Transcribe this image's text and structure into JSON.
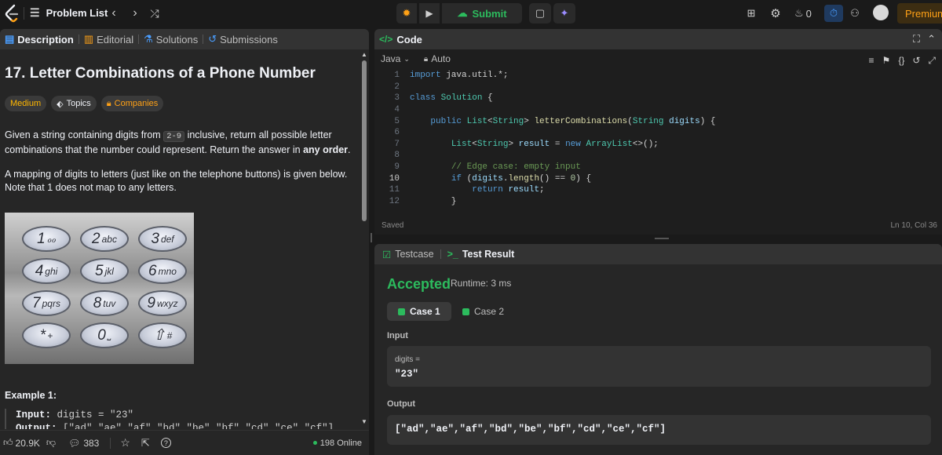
{
  "topbar": {
    "problem_list": "Problem List",
    "submit_label": "Submit",
    "streak_count": "0",
    "premium_label": "Premium"
  },
  "tabs": {
    "description": "Description",
    "editorial": "Editorial",
    "solutions": "Solutions",
    "submissions": "Submissions"
  },
  "problem": {
    "title": "17. Letter Combinations of a Phone Number",
    "difficulty": "Medium",
    "topics": "Topics",
    "companies": "Companies",
    "desc_part1": "Given a string containing digits from ",
    "desc_code": "2-9",
    "desc_part2": " inclusive, return all possible letter combinations that the number could represent. Return the answer in ",
    "desc_bold": "any order",
    "desc_part3": ".",
    "mapping_text": "A mapping of digits to letters (just like on the telephone buttons) is given below. Note that 1 does not map to any letters.",
    "keypad": [
      {
        "digit": "1",
        "letters": "ℴℴ"
      },
      {
        "digit": "2",
        "letters": "abc"
      },
      {
        "digit": "3",
        "letters": "def"
      },
      {
        "digit": "4",
        "letters": "ghi"
      },
      {
        "digit": "5",
        "letters": "jkl"
      },
      {
        "digit": "6",
        "letters": "mno"
      },
      {
        "digit": "7",
        "letters": "pqrs"
      },
      {
        "digit": "8",
        "letters": "tuv"
      },
      {
        "digit": "9",
        "letters": "wxyz"
      },
      {
        "digit": "*",
        "letters": "+"
      },
      {
        "digit": "0",
        "letters": "⎵"
      },
      {
        "digit": "⇧",
        "letters": "#"
      }
    ],
    "example_title": "Example 1:",
    "example_input_label": "Input:",
    "example_input": " digits = \"23\"",
    "example_output_label": "Output:",
    "example_output": " [\"ad\",\"ae\",\"af\",\"bd\",\"be\",\"bf\",\"cd\",\"ce\",\"cf\"]"
  },
  "footer": {
    "likes": "20.9K",
    "comments": "383",
    "online": "198 Online"
  },
  "code": {
    "title": "Code",
    "language": "Java",
    "mode": "Auto",
    "status": "Saved",
    "position": "Ln 10, Col 36",
    "current_line": 10,
    "lines": [
      "import java.util.*;",
      "",
      "class Solution {",
      "",
      "    public List<String> letterCombinations(String digits) {",
      "",
      "        List<String> result = new ArrayList<>();",
      "",
      "        // Edge case: empty input",
      "        if (digits.length() == 0) {",
      "            return result;",
      "        }"
    ]
  },
  "result": {
    "tab_testcase": "Testcase",
    "tab_result": "Test Result",
    "verdict": "Accepted",
    "runtime": "Runtime: 3 ms",
    "case1": "Case 1",
    "case2": "Case 2",
    "input_label": "Input",
    "input_var": "digits =",
    "input_value": "\"23\"",
    "output_label": "Output",
    "output_value": "[\"ad\",\"ae\",\"af\",\"bd\",\"be\",\"bf\",\"cd\",\"ce\",\"cf\"]"
  },
  "colors": {
    "accent_green": "#2cbb5d",
    "premium_orange": "#ffa116",
    "medium_yellow": "#ffb700"
  }
}
